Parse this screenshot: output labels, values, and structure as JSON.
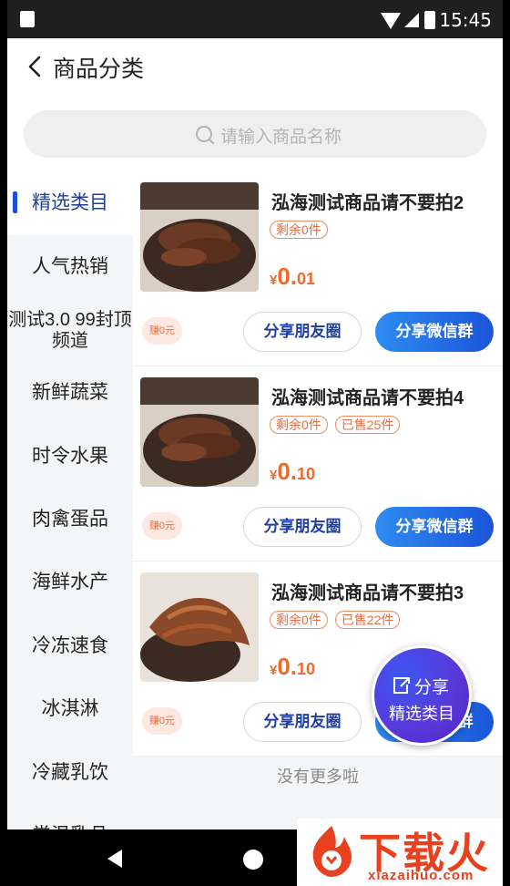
{
  "status_bar": {
    "time": "15:45"
  },
  "header": {
    "title": "商品分类"
  },
  "search": {
    "placeholder": "请输入商品名称"
  },
  "sidebar": {
    "items": [
      {
        "label": "精选类目",
        "active": true
      },
      {
        "label": "人气热销"
      },
      {
        "label": "测试3.0 99封顶频道"
      },
      {
        "label": "新鲜蔬菜"
      },
      {
        "label": "时令水果"
      },
      {
        "label": "肉禽蛋品"
      },
      {
        "label": "海鲜水产"
      },
      {
        "label": "冷冻速食"
      },
      {
        "label": "冰淇淋"
      },
      {
        "label": "冷藏乳饮"
      },
      {
        "label": "常温乳品"
      }
    ]
  },
  "products": [
    {
      "name": "泓海测试商品请不要拍2",
      "tags": [
        "剩余0件"
      ],
      "price_currency": "¥",
      "price_int": "0.",
      "price_dec": "01",
      "earn": "赚0元",
      "share_moments": "分享朋友圈",
      "share_wechat": "分享微信群"
    },
    {
      "name": "泓海测试商品请不要拍4",
      "tags": [
        "剩余0件",
        "已售25件"
      ],
      "price_currency": "¥",
      "price_int": "0.",
      "price_dec": "10",
      "earn": "赚0元",
      "share_moments": "分享朋友圈",
      "share_wechat": "分享微信群"
    },
    {
      "name": "泓海测试商品请不要拍3",
      "tags": [
        "剩余0件",
        "已售22件"
      ],
      "price_currency": "¥",
      "price_int": "0.",
      "price_dec": "10",
      "earn": "赚0元",
      "share_moments": "分享朋友圈",
      "share_wechat": "分享微信群"
    }
  ],
  "footer": {
    "no_more": "没有更多啦"
  },
  "fab": {
    "share": "分享",
    "category": "精选类目"
  },
  "watermark": {
    "brand": "下载火",
    "url": "xiazaihuo.com"
  },
  "colors": {
    "accent_blue": "#1c4fd8",
    "price_orange": "#ed6a2c",
    "tag_orange": "#e86d45"
  },
  "icons": [
    "back-arrow-icon",
    "search-icon",
    "share-icon"
  ]
}
